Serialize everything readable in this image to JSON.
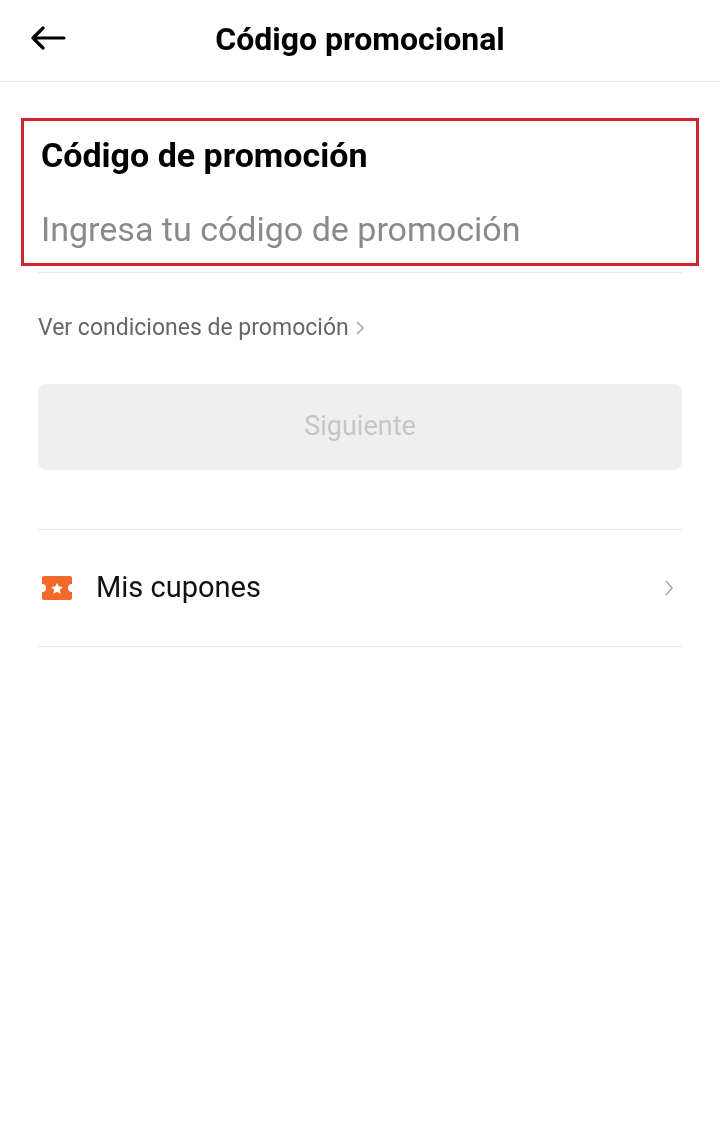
{
  "header": {
    "title": "Código promocional"
  },
  "promo_field": {
    "label": "Código de promoción",
    "placeholder": "Ingresa tu código de promoción",
    "highlighted": true
  },
  "conditions_link": {
    "label": "Ver condiciones de promoción"
  },
  "next_button": {
    "label": "Siguiente",
    "disabled": true
  },
  "menu_items": [
    {
      "label": "Mis cupones"
    }
  ]
}
